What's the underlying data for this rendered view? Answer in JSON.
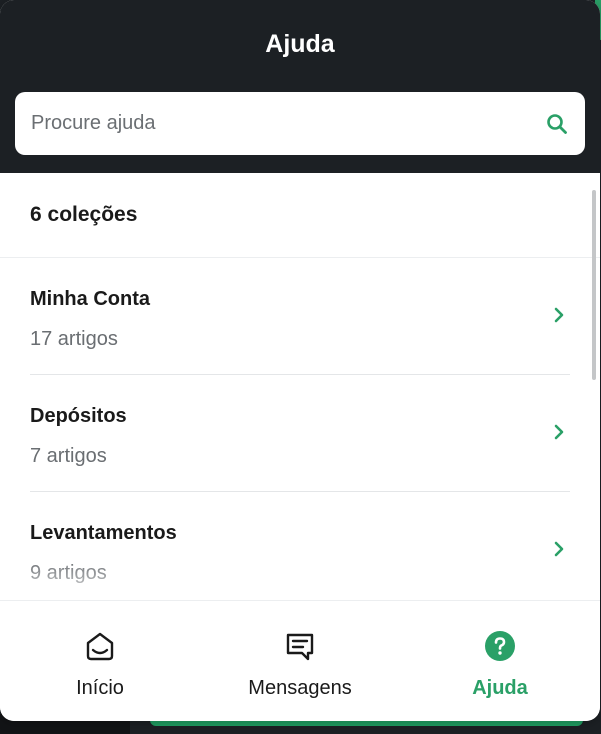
{
  "header": {
    "title": "Ajuda",
    "search_placeholder": "Procure ajuda"
  },
  "collections": {
    "count_label": "6 coleções",
    "items": [
      {
        "name": "Minha Conta",
        "articles": "17 artigos"
      },
      {
        "name": "Depósitos",
        "articles": "7 artigos"
      },
      {
        "name": "Levantamentos",
        "articles": "9 artigos"
      }
    ]
  },
  "nav": {
    "items": [
      {
        "label": "Início",
        "icon": "home-icon",
        "active": false
      },
      {
        "label": "Mensagens",
        "icon": "messages-icon",
        "active": false
      },
      {
        "label": "Ajuda",
        "icon": "help-icon",
        "active": true
      }
    ]
  },
  "colors": {
    "accent": "#2aa067",
    "header_bg": "#1c2024"
  }
}
